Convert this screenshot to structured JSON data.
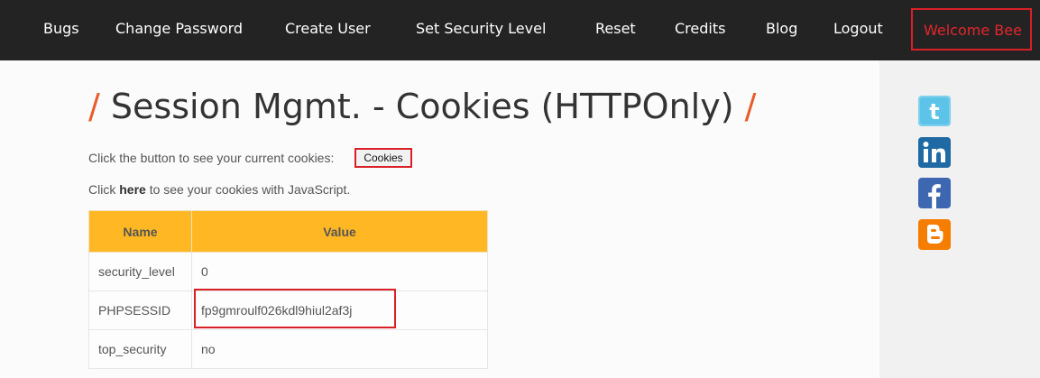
{
  "nav": {
    "items": [
      "Bugs",
      "Change Password",
      "Create User",
      "Set Security Level",
      "Reset",
      "Credits",
      "Blog",
      "Logout"
    ],
    "welcome": "Welcome Bee"
  },
  "page": {
    "title": "Session Mgmt. - Cookies (HTTPOnly)",
    "slash": "/",
    "prompt": "Click the button to see your current cookies:",
    "cookies_button": "Cookies",
    "click_pre": "Click",
    "click_link": "here",
    "click_post": "to see your cookies with JavaScript."
  },
  "table": {
    "headers": [
      "Name",
      "Value"
    ],
    "rows": [
      [
        "security_level",
        "0"
      ],
      [
        "PHPSESSID",
        "fp9gmroulf026kdl9hiul2af3j"
      ],
      [
        "top_security",
        "no"
      ]
    ]
  },
  "social": [
    "twitter-icon",
    "linkedin-icon",
    "facebook-icon",
    "blogger-icon"
  ],
  "colors": {
    "accent": "#e85c2b",
    "highlight": "#d92027",
    "header_bg": "#ffb823"
  }
}
